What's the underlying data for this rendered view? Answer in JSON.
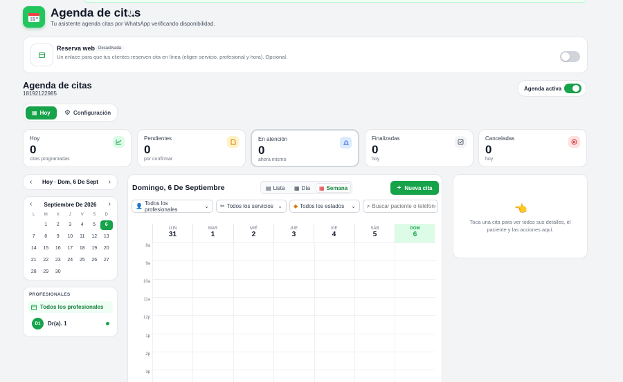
{
  "header": {
    "title": "Agenda de citas",
    "info": "i",
    "subtitle": "Tu asistente agenda citas por WhatsApp verificando disponibilidad."
  },
  "reserva": {
    "title": "Reserva web",
    "badge": "Desactivada",
    "description": "Un enlace para que tus clientes reserven cita en línea (eligen servicio, profesional y hora). Opcional.",
    "enabled": false
  },
  "agenda": {
    "title": "Agenda de citas",
    "phone": "18192122985",
    "active_label": "Agenda activa",
    "active": true
  },
  "tabs": [
    {
      "label": "Hoy",
      "active": true
    },
    {
      "label": "Configuración",
      "active": false
    }
  ],
  "stats": [
    {
      "label": "Hoy",
      "value": "0",
      "sub": "citas programadas",
      "icon": "chart-icon",
      "color": "#16a34a",
      "bg": "#dcfce7"
    },
    {
      "label": "Pendientes",
      "value": "0",
      "sub": "por confirmar",
      "icon": "document-icon",
      "color": "#d97706",
      "bg": "#fef3c7"
    },
    {
      "label": "En atención",
      "value": "0",
      "sub": "ahora mismo",
      "icon": "bell-icon",
      "color": "#2563eb",
      "bg": "#dbeafe"
    },
    {
      "label": "Finalizadas",
      "value": "0",
      "sub": "hoy",
      "icon": "check-square-icon",
      "color": "#4b5563",
      "bg": "#f3f4f6"
    },
    {
      "label": "Canceladas",
      "value": "0",
      "sub": "hoy",
      "icon": "x-circle-icon",
      "color": "#dc2626",
      "bg": "#fee2e2"
    }
  ],
  "date_nav": {
    "label": "Hoy · Dom, 6 De Sept"
  },
  "mini_calendar": {
    "month_label": "Septiembre De 2026",
    "weekdays": [
      "L",
      "M",
      "X",
      "J",
      "V",
      "S",
      "D"
    ],
    "weeks": [
      [
        "",
        "1",
        "2",
        "3",
        "4",
        "5",
        "6"
      ],
      [
        "7",
        "8",
        "9",
        "10",
        "11",
        "12",
        "13"
      ],
      [
        "14",
        "15",
        "16",
        "17",
        "18",
        "19",
        "20"
      ],
      [
        "21",
        "22",
        "23",
        "24",
        "25",
        "26",
        "27"
      ],
      [
        "28",
        "29",
        "30",
        "",
        "",
        "",
        ""
      ]
    ],
    "selected": "6"
  },
  "professionals": {
    "title": "PROFESIONALES",
    "all_label": "Todos los profesionales",
    "items": [
      {
        "initials": "D1",
        "name": "Dr(a). 1",
        "online": true
      }
    ]
  },
  "main": {
    "date_title": "Domingo, 6 De Septiembre",
    "views": [
      "Lista",
      "Día",
      "Semana"
    ],
    "active_view": "Semana",
    "new_button": "Nueva cita",
    "filters": {
      "profesionales": "Todos los profesionales",
      "servicios": "Todos los servicios",
      "estados": "Todos los estados",
      "search_placeholder": "Buscar paciente o teléfono"
    },
    "week": [
      {
        "day": "LUN",
        "num": "31",
        "today": false
      },
      {
        "day": "MAR",
        "num": "1",
        "today": false
      },
      {
        "day": "MIÉ",
        "num": "2",
        "today": false
      },
      {
        "day": "JUE",
        "num": "3",
        "today": false
      },
      {
        "day": "VIE",
        "num": "4",
        "today": false
      },
      {
        "day": "SÁB",
        "num": "5",
        "today": false
      },
      {
        "day": "DOM",
        "num": "6",
        "today": true
      }
    ],
    "hours": [
      "8a",
      "9a",
      "10a",
      "11a",
      "12p",
      "1p",
      "2p",
      "3p"
    ]
  },
  "detail_panel": {
    "icon": "pointing-hand-icon",
    "message": "Toca una cita para ver todos sus detalles, el paciente y las acciones aquí."
  },
  "colors": {
    "accent": "#16a34a",
    "accent_light": "#dcfce7"
  }
}
